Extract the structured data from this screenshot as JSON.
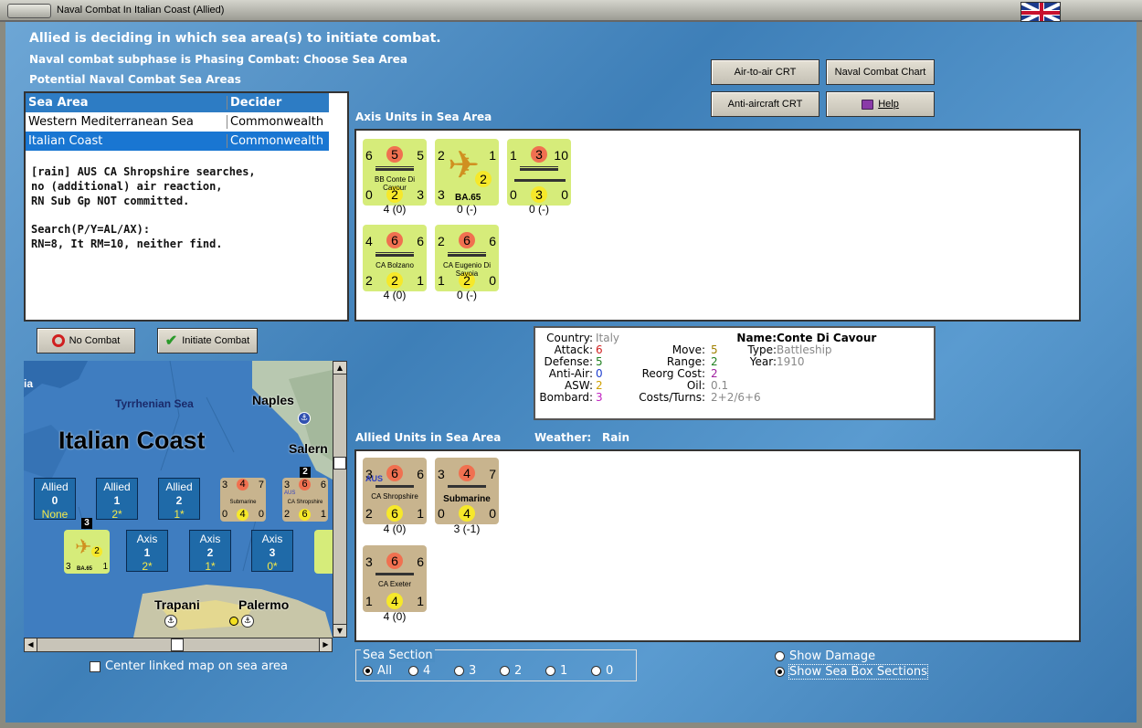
{
  "window": {
    "title": "Naval Combat In Italian Coast (Allied)"
  },
  "header": {
    "line1": "Allied is deciding in which sea area(s) to initiate combat.",
    "line2": "Naval combat subphase is Phasing Combat: Choose Sea Area",
    "line3": "Potential Naval Combat Sea Areas"
  },
  "buttons": {
    "air_to_air": "Air-to-air CRT",
    "naval_chart": "Naval Combat Chart",
    "anti_aircraft": "Anti-aircraft CRT",
    "help": "Help",
    "no_combat": "No Combat",
    "initiate": "Initiate Combat"
  },
  "sea_table": {
    "headers": [
      "Sea Area",
      "Decider"
    ],
    "rows": [
      [
        "Western Mediterranean Sea",
        "Commonwealth"
      ],
      [
        "Italian Coast",
        "Commonwealth"
      ]
    ],
    "selected": 1
  },
  "log": "[rain] AUS CA Shropshire searches,\nno (additional) air reaction,\nRN Sub Gp NOT committed.\n\nSearch(P/Y=AL/AX):\nRN=8, It RM=10, neither find.",
  "axis": {
    "title": "Axis Units in Sea Area",
    "units": [
      {
        "name": "BB Conte Di Cavour",
        "tl": "6",
        "tm": "5",
        "tr": "5",
        "bl": "0",
        "bm": "2",
        "br": "3",
        "status": "4 (0)"
      },
      {
        "name": "BA.65",
        "tl": "2",
        "tm": "",
        "tr": "1",
        "bl": "3",
        "bm": "2",
        "br": "",
        "status": "0 (-)"
      },
      {
        "name": "",
        "tl": "1",
        "tm": "3",
        "tr": "10",
        "bl": "0",
        "bm": "3",
        "br": "0",
        "status": "0 (-)"
      },
      {
        "name": "CA Bolzano",
        "tl": "4",
        "tm": "6",
        "tr": "6",
        "bl": "2",
        "bm": "2",
        "br": "1",
        "status": "4 (0)"
      },
      {
        "name": "CA Eugenio Di Savoia",
        "tl": "2",
        "tm": "6",
        "tr": "6",
        "bl": "1",
        "bm": "2",
        "br": "0",
        "status": "0 (-)"
      }
    ]
  },
  "info": {
    "country_lbl": "Country:",
    "country": "Italy",
    "attack_lbl": "Attack:",
    "attack": "6",
    "defense_lbl": "Defense:",
    "defense": "5",
    "aa_lbl": "Anti-Air:",
    "aa": "0",
    "asw_lbl": "ASW:",
    "asw": "2",
    "bombard_lbl": "Bombard:",
    "bombard": "3",
    "move_lbl": "Move:",
    "move": "5",
    "range_lbl": "Range:",
    "range": "2",
    "reorg_lbl": "Reorg Cost:",
    "reorg": "2",
    "oil_lbl": "Oil:",
    "oil": "0.1",
    "costs_lbl": "Costs/Turns:",
    "costs": "2+2/6+6",
    "name_lbl": "Name:",
    "name": "Conte Di Cavour",
    "type_lbl": "Type:",
    "type": "Battleship",
    "year_lbl": "Year:",
    "year": "1910"
  },
  "allied": {
    "title": "Allied Units in Sea Area",
    "weather_lbl": "Weather:",
    "weather": "Rain",
    "units": [
      {
        "name": "CA Shropshire",
        "tag": "AUS",
        "tl": "3",
        "tm": "6",
        "tr": "6",
        "bl": "2",
        "bm": "6",
        "br": "1",
        "status": "4 (0)"
      },
      {
        "name": "Submarine",
        "tag": "",
        "tl": "3",
        "tm": "4",
        "tr": "7",
        "bl": "0",
        "bm": "4",
        "br": "0",
        "status": "3 (-1)"
      },
      {
        "name": "CA Exeter",
        "tag": "",
        "tl": "3",
        "tm": "6",
        "tr": "6",
        "bl": "1",
        "bm": "4",
        "br": "1",
        "status": "4 (0)"
      }
    ]
  },
  "map": {
    "title": "Italian Coast",
    "sea": "Tyrrhenian Sea",
    "cities": [
      "Naples",
      "Salern",
      "Trapani",
      "Palermo"
    ],
    "left_label": "ia",
    "allied_boxes": [
      {
        "side": "Allied",
        "num": "0",
        "sub": "None"
      },
      {
        "side": "Allied",
        "num": "1",
        "sub": "2*"
      },
      {
        "side": "Allied",
        "num": "2",
        "sub": "1*"
      }
    ],
    "axis_boxes": [
      {
        "side": "Axis",
        "num": "1",
        "sub": "2*"
      },
      {
        "side": "Axis",
        "num": "2",
        "sub": "1*"
      },
      {
        "side": "Axis",
        "num": "3",
        "sub": "0*"
      }
    ],
    "stack_a": "2",
    "stack_b": "3",
    "mini_sub": {
      "name": "Submarine",
      "tl": "3",
      "tm": "4",
      "tr": "7",
      "bl": "0",
      "bm": "4",
      "br": "0"
    },
    "mini_shrop": {
      "name": "CA Shropshire",
      "tag": "AUS",
      "tl": "3",
      "tm": "6",
      "tr": "6",
      "bl": "2",
      "bm": "6",
      "br": "1"
    },
    "mini_ba": {
      "name": "BA.65",
      "tl": "3",
      "tr": "1",
      "bm": "2"
    }
  },
  "center_link": "Center linked map on sea area",
  "sea_section": {
    "legend": "Sea Section",
    "options": [
      "All",
      "4",
      "3",
      "2",
      "1",
      "0"
    ],
    "selected": 0
  },
  "view": {
    "damage": "Show Damage",
    "boxes": "Show Sea Box Sections"
  }
}
